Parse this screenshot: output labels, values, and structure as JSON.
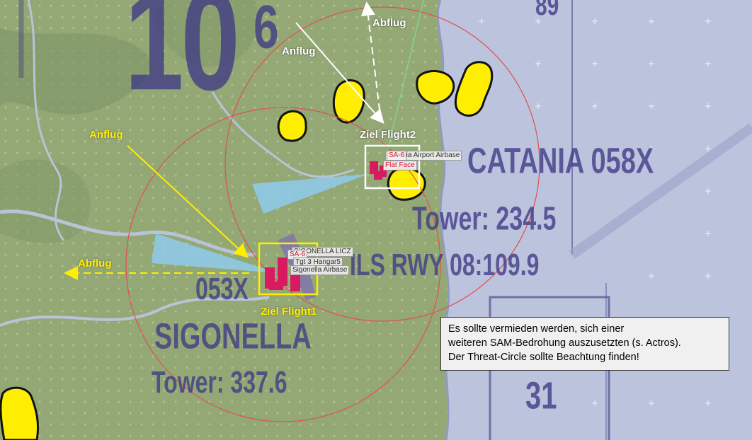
{
  "chart_labels": {
    "big_number": "10",
    "big_superscript": "6",
    "top_right_number": "89",
    "catania_name": "CATANIA 058X",
    "catania_tower": "Tower: 234.5",
    "catania_ils": "ILS RWY 08:109.9",
    "sigonella_channel": "053X",
    "sigonella_name": "SIGONELLA",
    "sigonella_tower": "Tower: 337.6",
    "runway_number": "31"
  },
  "map_tags": {
    "flight2_tag_sa6": "SA-6",
    "flight2_tag_airbase": "Catania Airport Airbase",
    "flight2_tag_flatface": "Flat Face",
    "flight1_tag_sa6": "SA-6",
    "flight1_tag_licz": "SIGONELLA LICZ",
    "flight1_tag_hangar": "Tgt 3 Hangar5",
    "flight1_tag_airbase": "Sigonella Airbase"
  },
  "annotations": {
    "flight2_anflug": "Anflug",
    "flight2_abflug": "Abflug",
    "flight2_target": "Ziel Flight2",
    "flight1_anflug": "Anflug",
    "flight1_abflug": "Abflug",
    "flight1_target": "Ziel Flight1"
  },
  "note": {
    "line1": "Es sollte vermieden werden, sich einer",
    "line2": "weiteren SAM-Bedrohung auszusetzten (s. Actros).",
    "line3": "Der Threat-Circle sollte Beachtung finden!"
  },
  "colors": {
    "land": "#93a875",
    "sea": "#bcc3dd",
    "threat_circle": "#e05050",
    "flight1_marker": "#ffee00",
    "flight2_marker": "#ffffff",
    "target_icon": "#d81b60",
    "sam_zone": "#ffee00"
  }
}
